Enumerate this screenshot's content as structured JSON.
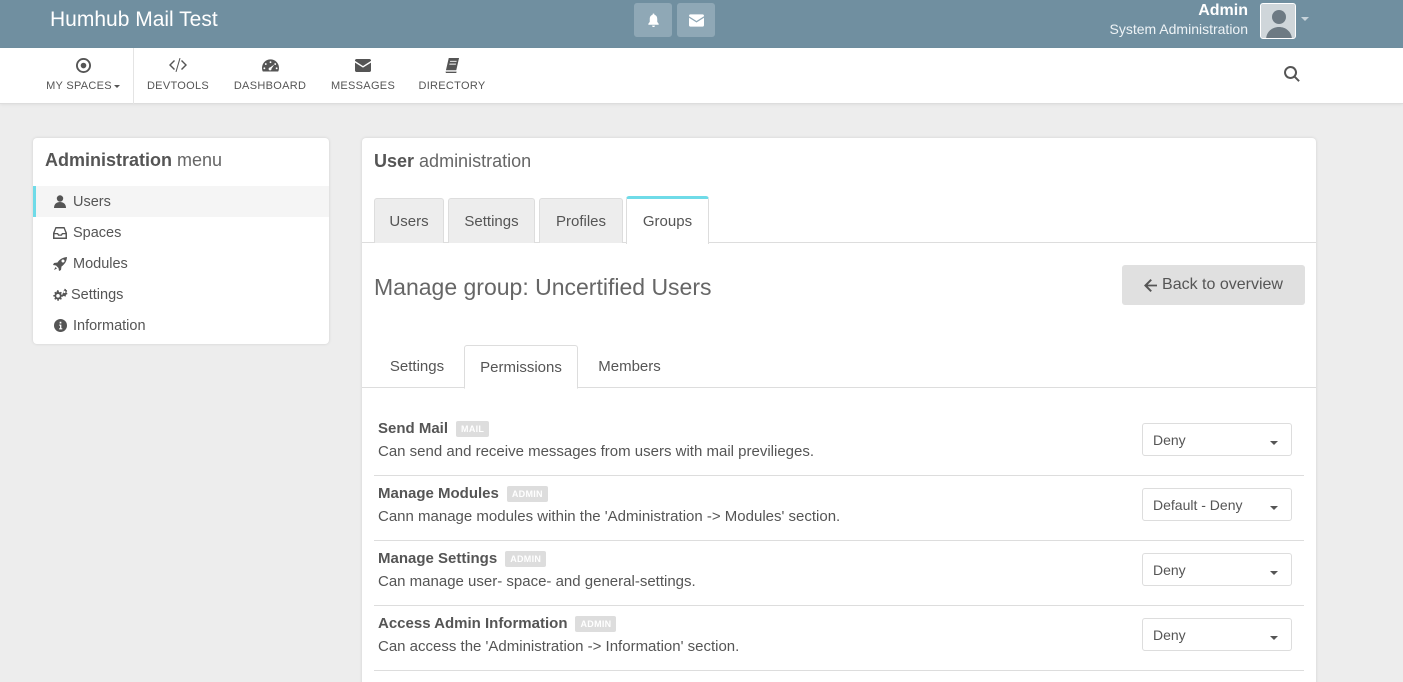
{
  "header": {
    "brand": "Humhub Mail Test",
    "user_name": "Admin",
    "user_role": "System Administration"
  },
  "nav": {
    "items": [
      {
        "label": "MY SPACES",
        "icon": "dot-circle-icon"
      },
      {
        "label": "DEVTOOLS",
        "icon": "code-icon"
      },
      {
        "label": "DASHBOARD",
        "icon": "tachometer-icon"
      },
      {
        "label": "MESSAGES",
        "icon": "envelope-icon"
      },
      {
        "label": "DIRECTORY",
        "icon": "book-icon"
      }
    ]
  },
  "admin_menu": {
    "title_bold": "Administration",
    "title_light": "menu",
    "items": [
      {
        "label": "Users",
        "icon": "user-icon",
        "active": true
      },
      {
        "label": "Spaces",
        "icon": "inbox-icon"
      },
      {
        "label": "Modules",
        "icon": "rocket-icon"
      },
      {
        "label": "Settings",
        "icon": "cogs-icon"
      },
      {
        "label": "Information",
        "icon": "info-circle-icon"
      }
    ]
  },
  "main": {
    "title_bold": "User",
    "title_light": "administration",
    "tabs": [
      {
        "label": "Users"
      },
      {
        "label": "Settings"
      },
      {
        "label": "Profiles"
      },
      {
        "label": "Groups",
        "active": true
      }
    ],
    "group_title": "Manage group: Uncertified Users",
    "back_button": "Back to overview",
    "sub_tabs": [
      {
        "label": "Settings"
      },
      {
        "label": "Permissions",
        "active": true
      },
      {
        "label": "Members"
      }
    ],
    "permissions": [
      {
        "title": "Send Mail",
        "badge": "MAIL",
        "description": "Can send and receive messages from users with mail previlieges.",
        "value": "Deny"
      },
      {
        "title": "Manage Modules",
        "badge": "ADMIN",
        "description": "Cann manage modules within the 'Administration -> Modules' section.",
        "value": "Default - Deny"
      },
      {
        "title": "Manage Settings",
        "badge": "ADMIN",
        "description": "Can manage user- space- and general-settings.",
        "value": "Deny"
      },
      {
        "title": "Access Admin Information",
        "badge": "ADMIN",
        "description": "Can access the 'Administration -> Information' section.",
        "value": "Deny"
      }
    ]
  },
  "colors": {
    "topbar": "#708fa0",
    "accent": "#6fdbe8",
    "background": "#ededed"
  }
}
